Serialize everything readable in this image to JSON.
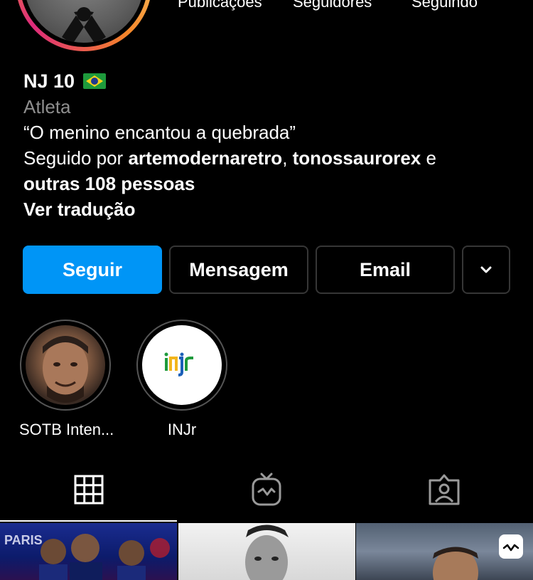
{
  "stats": {
    "posts_label": "Publicações",
    "followers_label": "Seguidores",
    "following_label": "Seguindo"
  },
  "profile": {
    "name": "NJ 10",
    "flag_emoji": "🇧🇷",
    "category": "Atleta",
    "bio": "“O menino encantou a quebrada”",
    "followed_by_prefix": "Seguido por ",
    "followed_by_user1": "artemodernaretro",
    "followed_by_sep": ", ",
    "followed_by_user2": "tonossaurorex",
    "followed_by_and": " e",
    "followed_by_others": "outras 108 pessoas",
    "translate_link": "Ver tradução"
  },
  "actions": {
    "follow_label": "Seguir",
    "message_label": "Mensagem",
    "email_label": "Email",
    "more_icon": "chevron-down-icon"
  },
  "highlights": [
    {
      "label": "SOTB Inten..."
    },
    {
      "label": "INJr",
      "logo_text": "INJR"
    }
  ],
  "tabs": [
    {
      "icon": "grid-icon",
      "active": true
    },
    {
      "icon": "igtv-icon",
      "active": false
    },
    {
      "icon": "tagged-icon",
      "active": false
    }
  ],
  "colors": {
    "accent": "#0095f6",
    "background": "#000000",
    "secondary_text": "#8e8e8e",
    "border": "#363636"
  }
}
